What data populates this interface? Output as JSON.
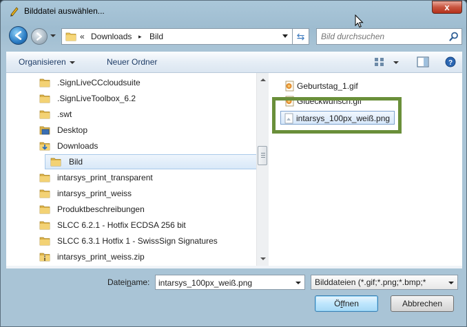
{
  "window": {
    "title": "Bilddatei auswählen...",
    "close_label": "x"
  },
  "address": {
    "chevrons": "«",
    "crumbs": [
      "Downloads",
      "Bild"
    ],
    "separator": "▸",
    "search_placeholder": "Bild durchsuchen"
  },
  "toolbar": {
    "organize": "Organisieren",
    "new_folder": "Neuer Ordner"
  },
  "tree": {
    "items": [
      {
        "label": ".SignLiveCCcloudsuite",
        "icon": "folder-icon"
      },
      {
        "label": ".SignLiveToolbox_6.2",
        "icon": "folder-icon"
      },
      {
        "label": ".swt",
        "icon": "folder-icon"
      },
      {
        "label": "Desktop",
        "icon": "desktop-icon"
      },
      {
        "label": "Downloads",
        "icon": "downloads-icon"
      },
      {
        "label": "Bild",
        "icon": "folder-icon",
        "selected": true
      },
      {
        "label": "intarsys_print_transparent",
        "icon": "folder-icon"
      },
      {
        "label": "intarsys_print_weiss",
        "icon": "folder-icon"
      },
      {
        "label": "Produktbeschreibungen",
        "icon": "folder-icon"
      },
      {
        "label": "SLCC 6.2.1 - Hotfix ECDSA 256 bit",
        "icon": "folder-icon"
      },
      {
        "label": "SLCC 6.3.1 Hotfix 1 - SwissSign Signatures",
        "icon": "folder-icon"
      },
      {
        "label": "intarsys_print_weiss.zip",
        "icon": "zip-icon"
      }
    ]
  },
  "files": {
    "items": [
      {
        "label": "Geburtstag_1.gif",
        "icon": "gif-file-icon"
      },
      {
        "label": "Glueckwunsch.gif",
        "icon": "gif-file-icon"
      },
      {
        "label": "intarsys_100px_weiß.png",
        "icon": "png-file-icon",
        "selected": true
      }
    ]
  },
  "bottom": {
    "filename_label_pre": "Datei",
    "filename_label_underlined": "n",
    "filename_label_post": "ame:",
    "filename_value": "intarsys_100px_weiß.png",
    "filetype": "Bilddateien (*.gif;*.png;*.bmp;*",
    "open_pre": "Ö",
    "open_underlined": "f",
    "open_post": "fnen",
    "cancel": "Abbrechen"
  },
  "colors": {
    "highlight_border": "#6a8f3a",
    "close_button": "#c8553f"
  }
}
